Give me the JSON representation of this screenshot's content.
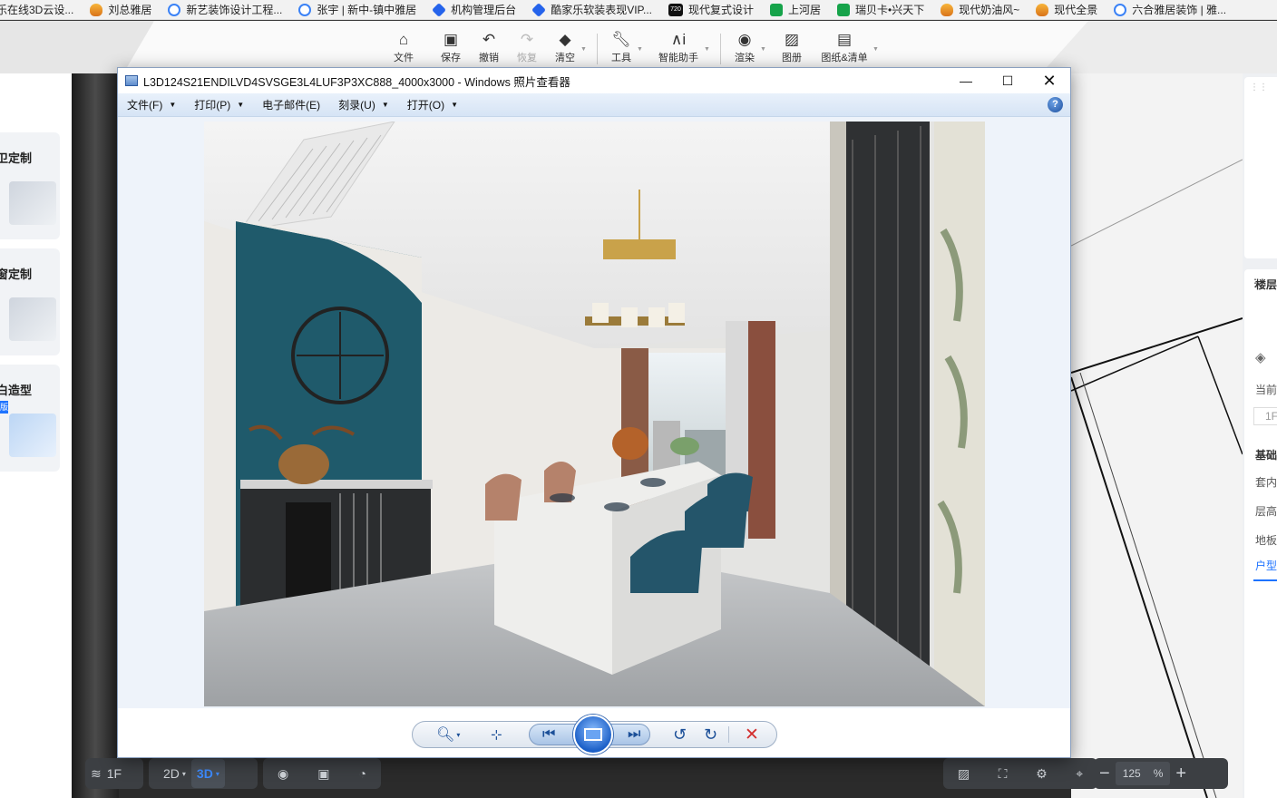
{
  "bookmarks": [
    {
      "label": "乐在线3D云设...",
      "icon": "flame-icon"
    },
    {
      "label": "刘总雅居",
      "icon": "flame-icon"
    },
    {
      "label": "新艺装饰设计工程...",
      "icon": "hexagon-icon"
    },
    {
      "label": "张宇 | 新中-镇中雅居",
      "icon": "hexagon-icon"
    },
    {
      "label": "机构管理后台",
      "icon": "diamond-icon"
    },
    {
      "label": "酷家乐软装表现VIP...",
      "icon": "diamond-icon"
    },
    {
      "label": "现代复式设计",
      "icon": "720-icon"
    },
    {
      "label": "上河居",
      "icon": "green-k-icon"
    },
    {
      "label": "瑞贝卡•兴天下",
      "icon": "green-k-icon"
    },
    {
      "label": "现代奶油风~",
      "icon": "flame-icon"
    },
    {
      "label": "现代全景",
      "icon": "flame-icon"
    },
    {
      "label": "六合雅居装饰 | 雅...",
      "icon": "hexagon-icon"
    }
  ],
  "toolbar": {
    "file": "文件",
    "save": "保存",
    "undo": "撤销",
    "redo": "恢复",
    "clear": "清空",
    "tools": "工具",
    "assistant": "智能助手",
    "render": "渲染",
    "album": "图册",
    "drawings": "图纸&清单"
  },
  "leftside": {
    "cards": [
      {
        "title": "卫定制"
      },
      {
        "title": "窗定制"
      },
      {
        "title": "白造型",
        "badge": "版"
      }
    ]
  },
  "rightpanel": {
    "floor_label": "楼层",
    "current": "当前",
    "floor_value": "1F",
    "basic": "基础",
    "suite": "套内",
    "height": "层高",
    "floor": "地板",
    "layout": "户型"
  },
  "bottom_left": {
    "floor": "1F",
    "mode_2d": "2D",
    "mode_3d": "3D"
  },
  "bottom_right": {
    "zoom_value": "125",
    "zoom_unit": "%"
  },
  "viewer": {
    "title": "L3D124S21ENDILVD4SVSGE3L4LUF3P3XC888_4000x3000 - Windows 照片查看器",
    "menu": {
      "file": "文件(F)",
      "print": "打印(P)",
      "email": "电子邮件(E)",
      "burn": "刻录(U)",
      "open": "打开(O)"
    }
  },
  "colors": {
    "accent_blue": "#1e73ff",
    "teal_wall": "#1f5a6b",
    "delete_red": "#d32f2f"
  }
}
